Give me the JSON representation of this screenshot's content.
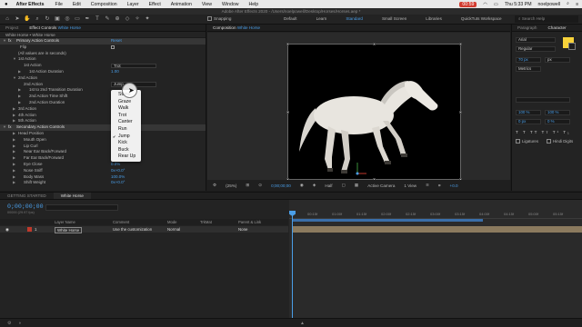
{
  "menubar": {
    "apple": "",
    "app": "After Effects",
    "items": [
      "File",
      "Edit",
      "Composition",
      "Layer",
      "Effect",
      "Animation",
      "View",
      "Window",
      "Help"
    ],
    "rec_time": "00:59",
    "clock": "Thu 5:33 PM",
    "user": "noelpowell"
  },
  "window_title": "Adobe After Effects 2020 - /Users/noelpowell/Desktop/Horses/Horses.aep *",
  "toolbar": {
    "snapping_label": "Snapping",
    "workspaces": [
      "Default",
      "Learn",
      "Standard",
      "Small Screen",
      "Libraries",
      "QuickTuts Workspace"
    ],
    "active_workspace": "Standard",
    "search_help_placeholder": "Search Help"
  },
  "project_tab": "Project",
  "effect_controls": {
    "tab_prefix": "Effect Controls",
    "tab_layer": "White Horse",
    "path": "White Horse • White Horse",
    "reset_label": "Reset",
    "rows": {
      "primary": "Primary Action Controls",
      "flip": "Flip",
      "note": "(All values are in seconds)",
      "first_action": "1st Action",
      "first_action_label": "1st Action",
      "first_action_value": "Trot",
      "first_duration": "1st Action Duration",
      "first_duration_value": "1.00",
      "second_action": "2nd Action",
      "second_action_label": "2nd Action",
      "second_action_value": "Jump",
      "transition": "1st to 2nd Transition Duration",
      "time_shift": "2nd Action Time Shift",
      "second_duration": "2nd Action Duration",
      "third_action": "3rd Action",
      "fourth_action": "4th Action",
      "fifth_action": "5th Action",
      "secondary": "Secondary Action Controls",
      "head_position": "Head Position",
      "mouth_open": "Mouth Open",
      "lip_curl": "Lip Curl",
      "near_ear": "Near Ear Back/Forward",
      "far_ear": "Far Ear Back/Forward",
      "eye_close": "Eye Close",
      "eye_close_value": "0.0%",
      "nose_sniff": "Nose Sniff",
      "nose_sniff_value": "0x+0.0°",
      "body_mass": "Body Mass",
      "body_mass_value": "100.0%",
      "shift_weight": "Shift Weight",
      "shift_weight_value": "0x+0.0°"
    }
  },
  "popup_menu": {
    "items": [
      "Stand",
      "Graze",
      "Walk",
      "Trot",
      "Canter",
      "Run",
      "Jump",
      "Kick",
      "Buck",
      "Rear Up"
    ],
    "checked": "Jump"
  },
  "composition": {
    "tab_prefix": "Composition",
    "tab_name": "White Horse",
    "zoom": "(25%)",
    "timecode": "0;00;00;00",
    "resolution": "Half",
    "camera": "Active Camera",
    "views": "1 View",
    "exposure": "+0.0"
  },
  "right_panel": {
    "paragraph_tab": "Paragraph",
    "character_tab": "Character",
    "font": "Arial",
    "style": "Regular",
    "size": "70 px",
    "leading": "px",
    "kerning_label": "Metrics",
    "scale_v": "100 %",
    "scale_h": "100 %",
    "baseline": "0 px",
    "tsume": "0 %",
    "ligatures": "Ligatures",
    "hindi_digits": "Hindi Digits",
    "fill_color": "#f7d23a"
  },
  "timeline": {
    "tabs": [
      "GETTING STARTED",
      "White Horse"
    ],
    "active_tab": "White Horse",
    "timecode": "0;00;00;00",
    "fps": "00000 (29.97 fps)",
    "headers": {
      "layer_name": "Layer Name",
      "comment": "Comment",
      "mode": "Mode",
      "trkmat": "TrkMat",
      "parent": "Parent & Link"
    },
    "layer": {
      "number": "1",
      "name": "White Horse",
      "comment": "Use the customization",
      "mode": "Normal",
      "parent": "None"
    },
    "ruler": [
      "0f",
      "00:15f",
      "01:00f",
      "01:15f",
      "02:00f",
      "02:15f",
      "03:00f",
      "03:15f",
      "04:00f",
      "04:15f",
      "05:00f",
      "05:15f"
    ]
  },
  "colors": {
    "accent": "#4a9ee8",
    "layer_bar": "#8b7a5e",
    "label_red": "#c0392b"
  }
}
